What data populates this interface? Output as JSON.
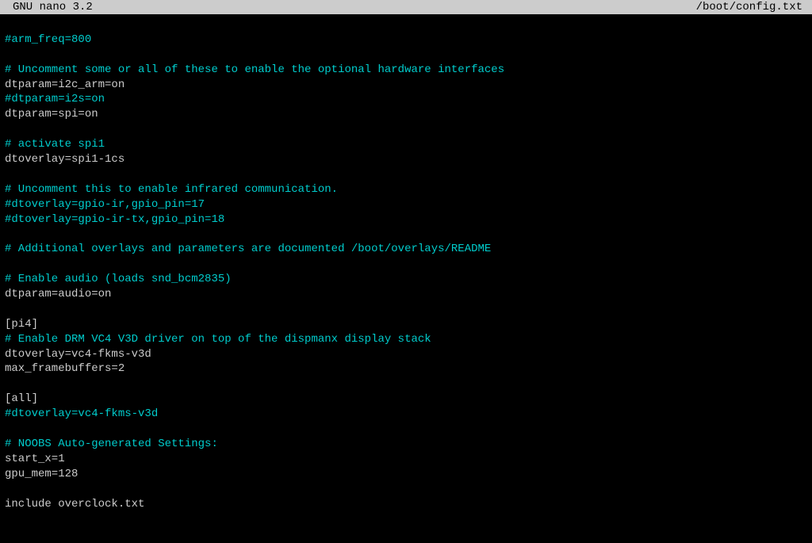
{
  "titlebar": {
    "app_name": "GNU nano 3.2",
    "filename": "/boot/config.txt"
  },
  "lines": [
    {
      "text": "",
      "type": "plain"
    },
    {
      "text": "#arm_freq=800",
      "type": "comment"
    },
    {
      "text": "",
      "type": "plain"
    },
    {
      "text": "# Uncomment some or all of these to enable the optional hardware interfaces",
      "type": "comment"
    },
    {
      "text": "dtparam=i2c_arm=on",
      "type": "plain"
    },
    {
      "text": "#dtparam=i2s=on",
      "type": "comment"
    },
    {
      "text": "dtparam=spi=on",
      "type": "plain"
    },
    {
      "text": "",
      "type": "plain"
    },
    {
      "text": "# activate spi1",
      "type": "comment"
    },
    {
      "text": "dtoverlay=spi1-1cs",
      "type": "plain"
    },
    {
      "text": "",
      "type": "plain"
    },
    {
      "text": "# Uncomment this to enable infrared communication.",
      "type": "comment"
    },
    {
      "text": "#dtoverlay=gpio-ir,gpio_pin=17",
      "type": "comment"
    },
    {
      "text": "#dtoverlay=gpio-ir-tx,gpio_pin=18",
      "type": "comment"
    },
    {
      "text": "",
      "type": "plain"
    },
    {
      "text": "# Additional overlays and parameters are documented /boot/overlays/README",
      "type": "comment"
    },
    {
      "text": "",
      "type": "plain"
    },
    {
      "text": "# Enable audio (loads snd_bcm2835)",
      "type": "comment"
    },
    {
      "text": "dtparam=audio=on",
      "type": "plain"
    },
    {
      "text": "",
      "type": "plain"
    },
    {
      "text": "[pi4]",
      "type": "plain"
    },
    {
      "text": "# Enable DRM VC4 V3D driver on top of the dispmanx display stack",
      "type": "comment"
    },
    {
      "text": "dtoverlay=vc4-fkms-v3d",
      "type": "plain"
    },
    {
      "text": "max_framebuffers=2",
      "type": "plain"
    },
    {
      "text": "",
      "type": "plain"
    },
    {
      "text": "[all]",
      "type": "plain"
    },
    {
      "text": "#dtoverlay=vc4-fkms-v3d",
      "type": "comment"
    },
    {
      "text": "",
      "type": "plain"
    },
    {
      "text": "# NOOBS Auto-generated Settings:",
      "type": "comment"
    },
    {
      "text": "start_x=1",
      "type": "plain"
    },
    {
      "text": "gpu_mem=128",
      "type": "plain"
    },
    {
      "text": "",
      "type": "plain"
    },
    {
      "text": "include overclock.txt",
      "type": "plain"
    }
  ]
}
